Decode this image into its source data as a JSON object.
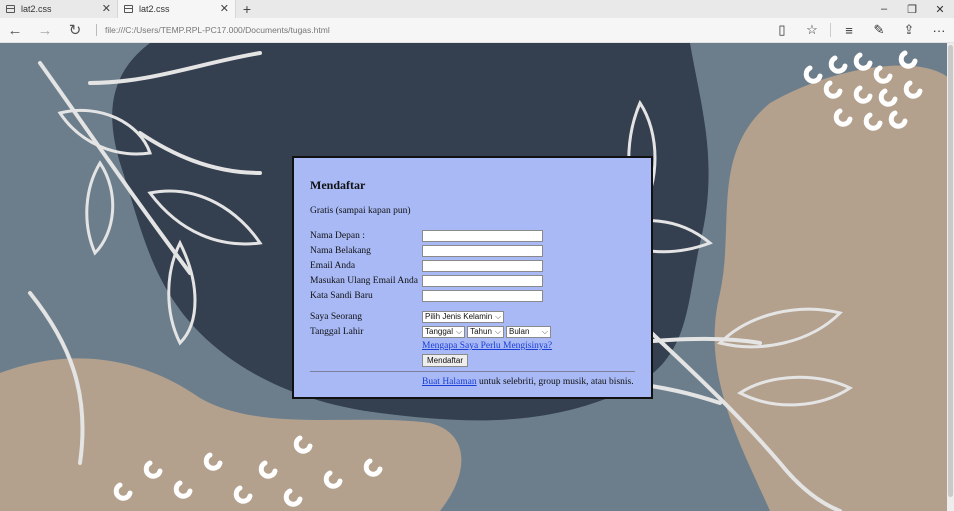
{
  "tabs": [
    {
      "title": "lat2.css",
      "active": false
    },
    {
      "title": "lat2.css",
      "active": true
    }
  ],
  "address": {
    "url": "file:///C:/Users/TEMP.RPL-PC17.000/Documents/tugas.html"
  },
  "form": {
    "title": "Mendaftar",
    "subtitle": "Gratis (sampai kapan pun)",
    "labels": {
      "first_name": "Nama Depan :",
      "last_name": "Nama Belakang",
      "email": "Email Anda",
      "email_repeat": "Masukan Ulang Email Anda",
      "password": "Kata Sandi Baru",
      "gender": "Saya Seorang",
      "birthdate": "Tanggal Lahir"
    },
    "values": {
      "first_name": "",
      "last_name": "",
      "email": "",
      "email_repeat": "",
      "password": ""
    },
    "gender_select": "Pilih Jenis Kelamin",
    "date_selects": {
      "day": "Tanggal",
      "year": "Tahun",
      "month": "Bulan"
    },
    "why_link": "Mengapa Saya Perlu Mengisinya?",
    "submit_label": "Mendaftar",
    "footer_link": "Buat Halaman",
    "footer_text": "untuk selebriti, group musik, atau bisnis."
  },
  "colors": {
    "form_bg": "#a8b9f5",
    "link": "#1a3ed6",
    "bg_slate": "#6c7e8c",
    "bg_navy": "#343f50",
    "bg_tan": "#b3a08d"
  }
}
